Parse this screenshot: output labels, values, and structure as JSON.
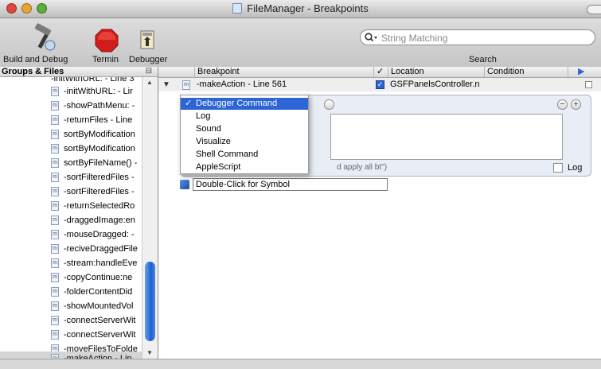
{
  "window": {
    "title": "FileManager - Breakpoints",
    "traffic_light_colors": {
      "close": "#e2463f",
      "minimize": "#e7a52f",
      "zoom": "#5cae3b"
    }
  },
  "toolbar": {
    "build_debug_label": "Build and Debug",
    "terminate_label": "Termin",
    "debugger_label": "Debugger",
    "search_placeholder": "String Matching",
    "search_label": "Search",
    "build_icon": "hammer-icon",
    "terminate_icon": "stop-sign-icon",
    "debugger_icon": "debugger-window-icon",
    "accent": "#d21c1c"
  },
  "left": {
    "header": "Groups & Files",
    "items": [
      {
        "label": "-initWithURL: - Line 3"
      },
      {
        "label": "-initWithURL: - Lir"
      },
      {
        "label": "-showPathMenu: -"
      },
      {
        "label": "-returnFiles - Line"
      },
      {
        "label": "sortByModification"
      },
      {
        "label": "sortByModification"
      },
      {
        "label": "sortByFileName() -"
      },
      {
        "label": "-sortFilteredFiles -"
      },
      {
        "label": "-sortFilteredFiles -"
      },
      {
        "label": "-returnSelectedRo"
      },
      {
        "label": "-draggedImage:en"
      },
      {
        "label": "-mouseDragged: -"
      },
      {
        "label": "-reciveDraggedFile"
      },
      {
        "label": "-stream:handleEve"
      },
      {
        "label": "-copyContinue:ne"
      },
      {
        "label": "-folderContentDid"
      },
      {
        "label": "-showMountedVol"
      },
      {
        "label": "-connectServerWit"
      },
      {
        "label": "-connectServerWit"
      },
      {
        "label": "-moveFilesToFolde"
      },
      {
        "label": "-makeAction - Lin"
      }
    ]
  },
  "breakpoints": {
    "columns": {
      "breakpoint": "Breakpoint",
      "check": "✓",
      "location": "Location",
      "condition": "Condition"
    },
    "row": {
      "label": "-makeAction - Line 561",
      "location": "GSFPanelsController.n",
      "enabled": true
    },
    "apply_all_text": "d apply all bt\")",
    "log_label": "Log",
    "symbol_placeholder": "Double-Click for Symbol",
    "action_menu": {
      "selected": "Debugger Command",
      "items": [
        "Debugger Command",
        "Log",
        "Sound",
        "Visualize",
        "Shell Command",
        "AppleScript"
      ]
    }
  },
  "colors": {
    "selection": "#2d64d6",
    "scroll_thumb": "#1a62d0"
  }
}
